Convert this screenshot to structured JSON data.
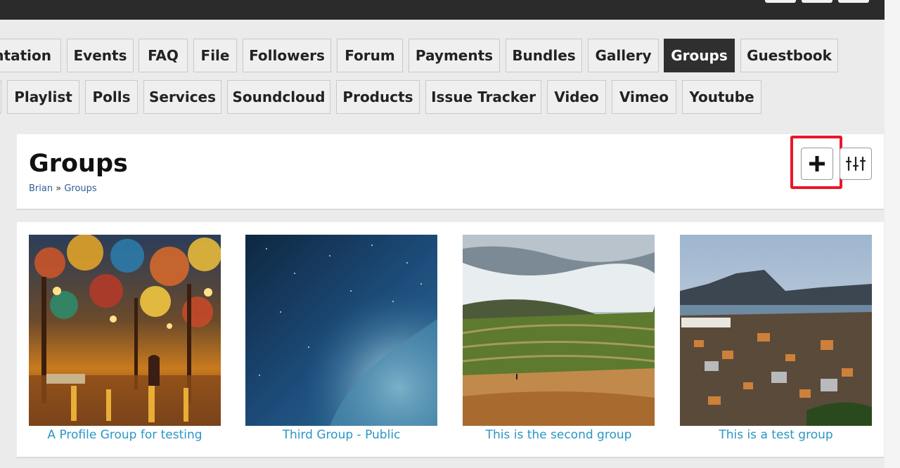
{
  "nav": {
    "row1": [
      {
        "label": "ntation",
        "active": false
      },
      {
        "label": "Events",
        "active": false
      },
      {
        "label": "FAQ",
        "active": false
      },
      {
        "label": "File",
        "active": false
      },
      {
        "label": "Followers",
        "active": false
      },
      {
        "label": "Forum",
        "active": false
      },
      {
        "label": "Payments",
        "active": false
      },
      {
        "label": "Bundles",
        "active": false
      },
      {
        "label": "Gallery",
        "active": false
      },
      {
        "label": "Groups",
        "active": true
      },
      {
        "label": "Guestbook",
        "active": false
      }
    ],
    "row2": [
      {
        "label": "",
        "active": false
      },
      {
        "label": "Playlist",
        "active": false
      },
      {
        "label": "Polls",
        "active": false
      },
      {
        "label": "Services",
        "active": false
      },
      {
        "label": "Soundcloud",
        "active": false
      },
      {
        "label": "Products",
        "active": false
      },
      {
        "label": "Issue Tracker",
        "active": false
      },
      {
        "label": "Video",
        "active": false
      },
      {
        "label": "Vimeo",
        "active": false
      },
      {
        "label": "Youtube",
        "active": false
      }
    ]
  },
  "page": {
    "title": "Groups",
    "breadcrumb": {
      "user": "Brian",
      "separator": "»",
      "current": "Groups"
    }
  },
  "actions": {
    "add_icon": "plus-icon",
    "filter_icon": "sort-filter-icon",
    "highlight_color": "#e8182a"
  },
  "groups": [
    {
      "title": "A Profile Group for testing",
      "image": "painted-park-autumn-night"
    },
    {
      "title": "Third Group - Public",
      "image": "starry-blue-sky"
    },
    {
      "title": "This is the second group",
      "image": "rice-terraces-in-clouds"
    },
    {
      "title": "This is a test group",
      "image": "coastal-town-at-dusk"
    }
  ],
  "colors": {
    "link": "#2b96c6",
    "active_tab": "#2f2f2f",
    "topbar": "#2b2b2b"
  }
}
